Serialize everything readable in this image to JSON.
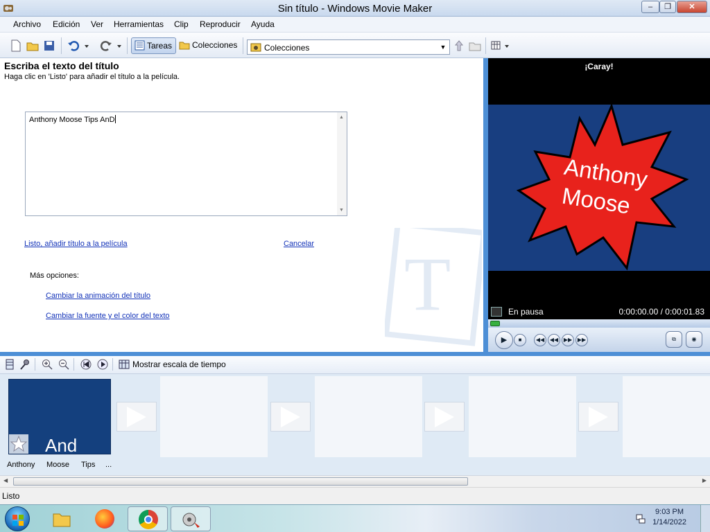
{
  "window": {
    "title": "Sin título - Windows Movie Maker",
    "controls": {
      "minimize": "–",
      "maximize": "❐",
      "close": "✕"
    }
  },
  "menu": [
    "Archivo",
    "Edición",
    "Ver",
    "Herramientas",
    "Clip",
    "Reproducir",
    "Ayuda"
  ],
  "toolbar": {
    "tasks_label": "Tareas",
    "collections_label": "Colecciones",
    "collections_combo": "Colecciones"
  },
  "taskpane": {
    "heading": "Escriba el texto del título",
    "instruction": "Haga clic en 'Listo' para añadir el título a la película.",
    "title_text": "Anthony Moose Tips AnD",
    "done_link": "Listo, añadir título a la película",
    "cancel_link": "Cancelar",
    "more_options_label": "Más opciones:",
    "option_animation": "Cambiar la animación del título",
    "option_font": "Cambiar la fuente y el color del texto",
    "watermark_letter": "T"
  },
  "preview": {
    "caption": "¡Caray!",
    "title_line1": "Anthony",
    "title_line2": "Moose",
    "state": "En pausa",
    "time": "0:00:00.00 / 0:00:01.83",
    "progress": 0
  },
  "storyboard": {
    "toolbar_label": "Mostrar escala de tiempo",
    "first_clip_text": "And",
    "first_clip_words": [
      "Anthony",
      "Moose",
      "Tips",
      "..."
    ]
  },
  "status": {
    "text": "Listo"
  },
  "taskbar": {
    "time": "9:03 PM",
    "date": "1/14/2022"
  },
  "colors": {
    "accent": "#4d8fd6",
    "clip_bg": "#14407e",
    "starburst": "#e8221c",
    "link": "#1232b8"
  }
}
